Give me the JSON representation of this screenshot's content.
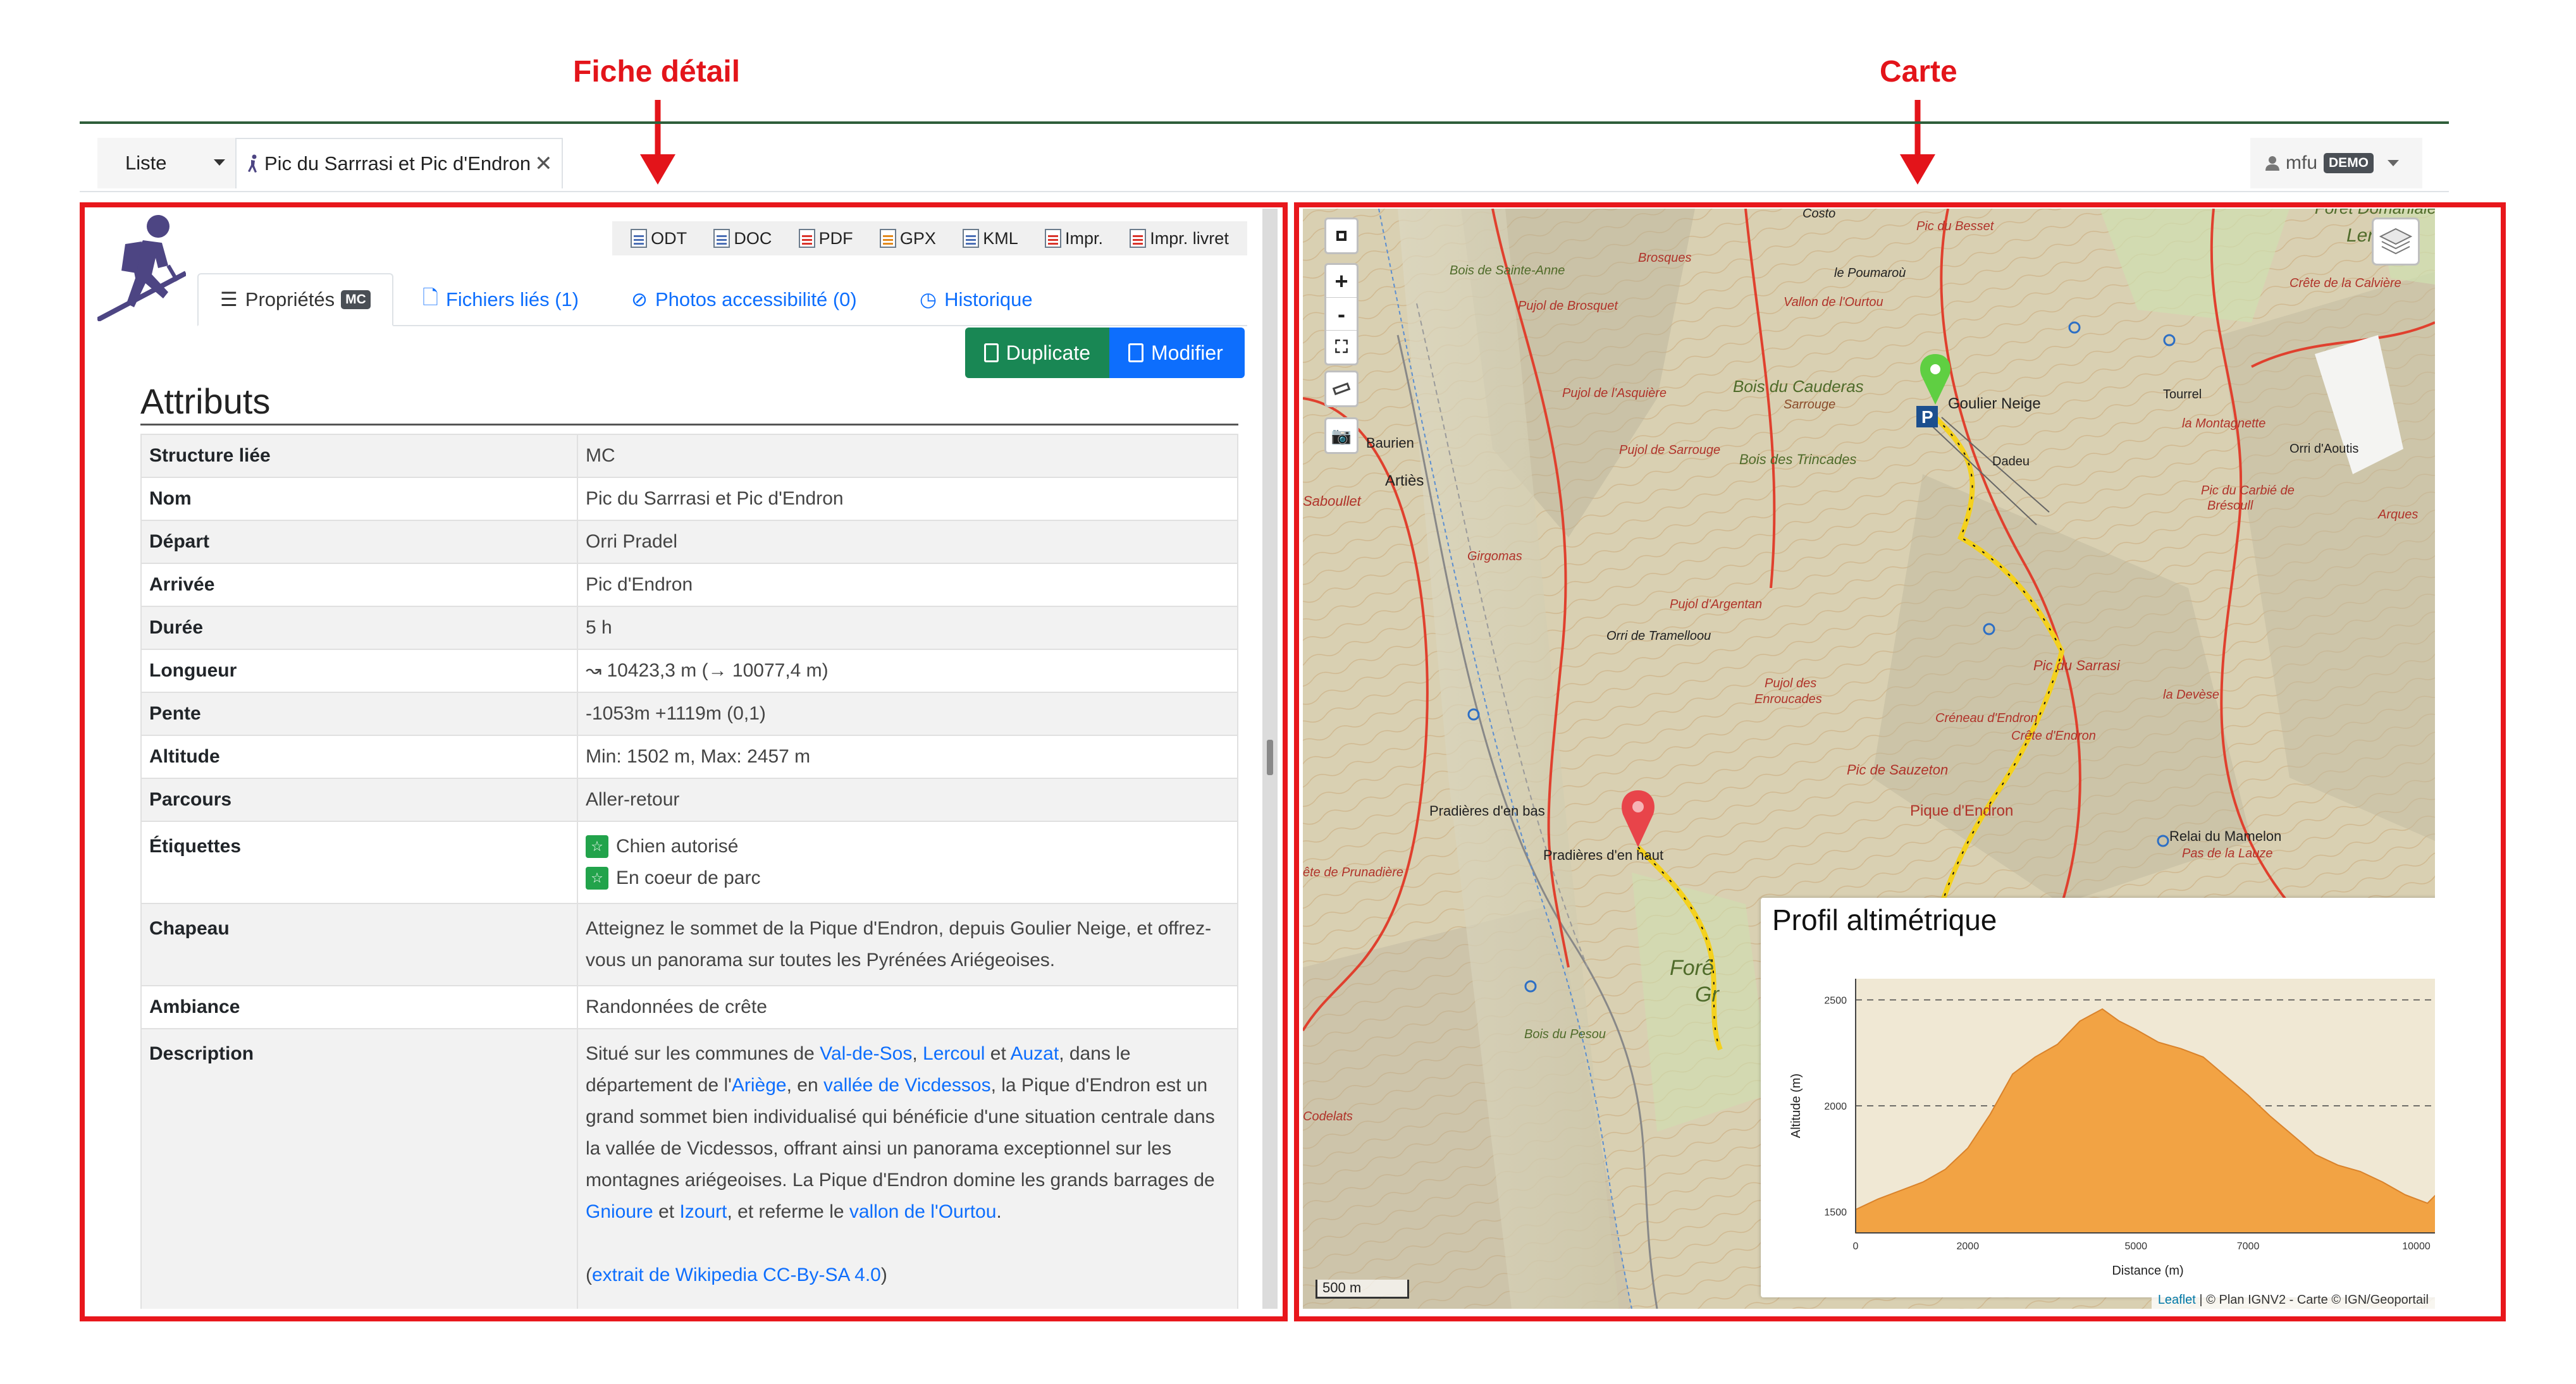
{
  "annotations": {
    "left_label": "Fiche détail",
    "right_label": "Carte"
  },
  "nav": {
    "list_label": "Liste",
    "current_tab": "Pic du Sarrrasi et Pic d'Endron",
    "close_symbol": "✕",
    "user": "mfu",
    "user_badge": "DEMO"
  },
  "exports": [
    "ODT",
    "DOC",
    "PDF",
    "GPX",
    "KML",
    "Impr.",
    "Impr. livret"
  ],
  "tabs": {
    "properties": "Propriétés",
    "properties_badge": "MC",
    "files": "Fichiers liés (1)",
    "photos": "Photos accessibilité (0)",
    "history": "Historique"
  },
  "buttons": {
    "duplicate": "Duplicate",
    "edit": "Modifier"
  },
  "section_title": "Attributs",
  "attributes": {
    "structure": {
      "key": "Structure liée",
      "value": "MC"
    },
    "name": {
      "key": "Nom",
      "value": "Pic du Sarrrasi et Pic d'Endron"
    },
    "departure": {
      "key": "Départ",
      "value": "Orri Pradel"
    },
    "arrival": {
      "key": "Arrivée",
      "value": "Pic d'Endron"
    },
    "duration": {
      "key": "Durée",
      "value": "5 h"
    },
    "length": {
      "key": "Longueur",
      "value": "↝ 10423,3 m (→ 10077,4 m)"
    },
    "slope": {
      "key": "Pente",
      "value": "-1053m +1119m (0,1)"
    },
    "altitude": {
      "key": "Altitude",
      "value": "Min: 1502 m, Max: 2457 m"
    },
    "route": {
      "key": "Parcours",
      "value": "Aller-retour"
    },
    "labels": {
      "key": "Étiquettes",
      "tag1": "Chien autorisé",
      "tag2": "En coeur de parc"
    },
    "headline": {
      "key": "Chapeau",
      "value": "Atteignez le sommet de la Pique d'Endron, depuis Goulier Neige, et offrez-vous un panorama sur toutes les Pyrénées Ariégeoises."
    },
    "ambiance": {
      "key": "Ambiance",
      "value": "Randonnées de crête"
    },
    "description": {
      "key": "Description",
      "t1": "Situé sur les communes de ",
      "l1": "Val-de-Sos",
      "t2": ", ",
      "l2": "Lercoul",
      "t3": " et ",
      "l3": "Auzat",
      "t4": ", dans le département de l'",
      "l4": "Ariège",
      "t5": ", en ",
      "l5": "vallée de Vicdessos",
      "t6": ", la Pique d'Endron est un grand sommet bien individualisé qui bénéficie d'une situation centrale dans la vallée de Vicdessos, offrant ainsi un panorama exceptionnel sur les montagnes ariégeoises. La Pique d'Endron domine les grands barrages de ",
      "l6": "Gnioure",
      "t7": " et ",
      "l7": "Izourt",
      "t8": ", et referme le ",
      "l8": "vallon de l'Ourtou",
      "t9": ".",
      "l9": "extrait de Wikipedia CC-By-SA 4.0",
      "open": "(",
      "close": ")"
    }
  },
  "map": {
    "scale": "500 m",
    "attribution_link": "Leaflet",
    "attribution_text": " | © Plan IGNV2 - Carte © IGN/Geoportail",
    "place_labels": [
      "Goulier Neige",
      "Bois du Cauderas",
      "Artiès",
      "Baurien",
      "Pradières d'en bas",
      "Pradières d'en haut",
      "Pique d'Endron",
      "Relai du Mamelon",
      "Pic du Sarrasi",
      "Orri d'Aoutis",
      "Tourrel",
      "Bois des Trincades",
      "Orri de Tramelloou",
      "Pic de Sauzeton",
      "Forê",
      "Gr",
      "Bois du Pesou",
      "Codelats",
      "Crête de la Calvière",
      "Pic du Besset",
      "Forêt Domaniale",
      "Lerco",
      "Le Poumaroù",
      "Pujol de Brosquet",
      "Pujol de l'Asquière",
      "Bois de Sainte-Anne",
      "Brosques",
      "Pic du Carbié de Brésoull",
      "Pas de la Lauze",
      "Crête de Prunadière",
      "Crêneau d'Endron",
      "Crête d'Endron",
      "la Devèse",
      "Pujol des Enroucades",
      "Pujol d'Argentan",
      "Pujol de Sarrouge",
      "Girgomas",
      "Saboullet",
      "la Montagnette",
      "Dadeu",
      "Arques",
      "Vallon de l'Ourtou",
      "Costo",
      "Sarrouge"
    ]
  },
  "profile": {
    "title": "Profil altimétrique",
    "expand_symbol": "↘"
  },
  "chart_data": {
    "type": "area",
    "title": "",
    "xlabel": "Distance (m)",
    "ylabel": "Altitude (m)",
    "xlim": [
      0,
      10423
    ],
    "ylim": [
      1400,
      2600
    ],
    "xticks": [
      0,
      2000,
      5000,
      7000,
      10000
    ],
    "xtick_labels": [
      "0",
      "2000",
      "5000",
      "7000",
      "10000"
    ],
    "yticks": [
      1500,
      2000,
      2500
    ],
    "ytick_labels": [
      "1500",
      "2000",
      "2500"
    ],
    "grid": "horizontal dashed",
    "color": "#f2a344",
    "x": [
      0,
      400,
      800,
      1200,
      1600,
      2000,
      2400,
      2800,
      3200,
      3600,
      4000,
      4400,
      4700,
      5000,
      5400,
      5800,
      6200,
      6600,
      7000,
      7400,
      7800,
      8200,
      8600,
      9000,
      9400,
      9800,
      10000,
      10200,
      10423
    ],
    "y": [
      1510,
      1560,
      1600,
      1640,
      1700,
      1800,
      1960,
      2150,
      2230,
      2290,
      2400,
      2457,
      2400,
      2360,
      2300,
      2270,
      2230,
      2140,
      2050,
      1950,
      1860,
      1770,
      1720,
      1690,
      1640,
      1580,
      1560,
      1540,
      1600
    ]
  }
}
